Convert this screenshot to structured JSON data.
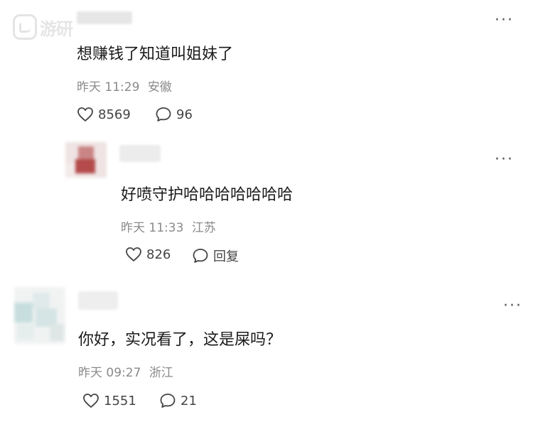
{
  "watermark": {
    "text": "游研"
  },
  "comments": [
    {
      "text": "想赚钱了知道叫姐妹了",
      "time": "昨天 11:29",
      "location": "安徽",
      "likes": "8569",
      "replies": "96"
    },
    {
      "text": "好喷守护哈哈哈哈哈哈哈",
      "time": "昨天 11:33",
      "location": "江苏",
      "likes": "826",
      "reply_label": "回复"
    },
    {
      "text": "你好，实况看了，这是屎吗？",
      "time": "昨天 09:27",
      "location": "浙江",
      "likes": "1551",
      "replies": "21"
    }
  ],
  "more_label": "···",
  "icons": {
    "like": "heart-outline-icon",
    "comment": "speech-bubble-icon",
    "more": "more-dots-icon"
  }
}
